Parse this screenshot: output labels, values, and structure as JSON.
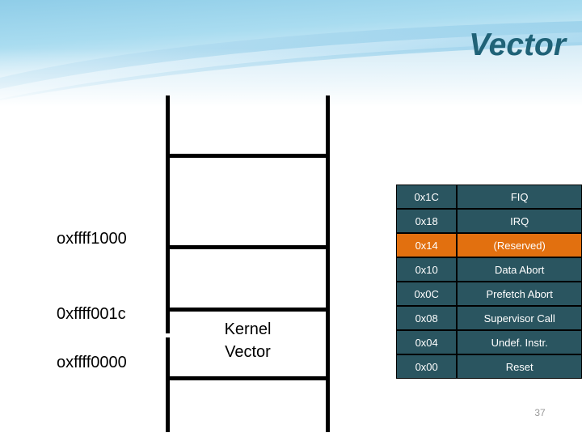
{
  "slide": {
    "title": "Vector",
    "page_number": "37",
    "title_color": "#1f6277",
    "banner_color_top": "#6dbbe0",
    "banner_color_bottom": "#ffffff"
  },
  "diagram": {
    "region_label_line1": "Kernel",
    "region_label_line2": "Vector",
    "addresses": [
      {
        "text": "oxffff1000"
      },
      {
        "text": "0xffff001c"
      },
      {
        "text": "oxffff0000"
      }
    ]
  },
  "vector_table": {
    "cell_color": "#2a5560",
    "highlight_color": "#e2700f",
    "rows": [
      {
        "address": "0x1C",
        "name": "FIQ",
        "highlight": false
      },
      {
        "address": "0x18",
        "name": "IRQ",
        "highlight": false
      },
      {
        "address": "0x14",
        "name": "(Reserved)",
        "highlight": true
      },
      {
        "address": "0x10",
        "name": "Data Abort",
        "highlight": false
      },
      {
        "address": "0x0C",
        "name": "Prefetch Abort",
        "highlight": false
      },
      {
        "address": "0x08",
        "name": "Supervisor Call",
        "highlight": false
      },
      {
        "address": "0x04",
        "name": "Undef. Instr.",
        "highlight": false
      },
      {
        "address": "0x00",
        "name": "Reset",
        "highlight": false
      }
    ]
  }
}
